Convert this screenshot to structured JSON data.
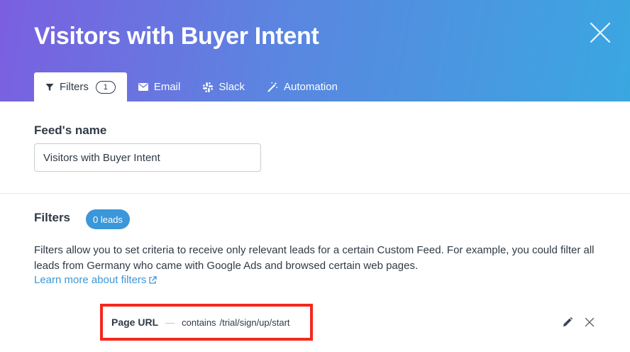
{
  "modal": {
    "title": "Visitors with Buyer Intent"
  },
  "tabs": [
    {
      "label": "Filters",
      "icon": "filter-icon",
      "badge": "1",
      "active": true
    },
    {
      "label": "Email",
      "icon": "envelope-icon",
      "active": false
    },
    {
      "label": "Slack",
      "icon": "slack-icon",
      "active": false
    },
    {
      "label": "Automation",
      "icon": "magic-wand-icon",
      "active": false
    }
  ],
  "feed": {
    "label": "Feed's name",
    "value": "Visitors with Buyer Intent"
  },
  "filters": {
    "heading": "Filters",
    "leads_badge": "0 leads",
    "description": "Filters allow you to set criteria to receive only relevant leads for a certain Custom Feed. For example, you could filter all leads from Germany who came with Google Ads and browsed certain web pages.",
    "learn_more": "Learn more about filters",
    "rules": [
      {
        "field": "Page URL",
        "separator": "—",
        "operator": "contains",
        "value": "/trial/sign/up/start"
      }
    ]
  },
  "colors": {
    "header_gradient_start": "#7b5fe0",
    "header_gradient_end": "#3aa7e1",
    "accent": "#3a97d9",
    "highlight_border": "#f5281e"
  }
}
